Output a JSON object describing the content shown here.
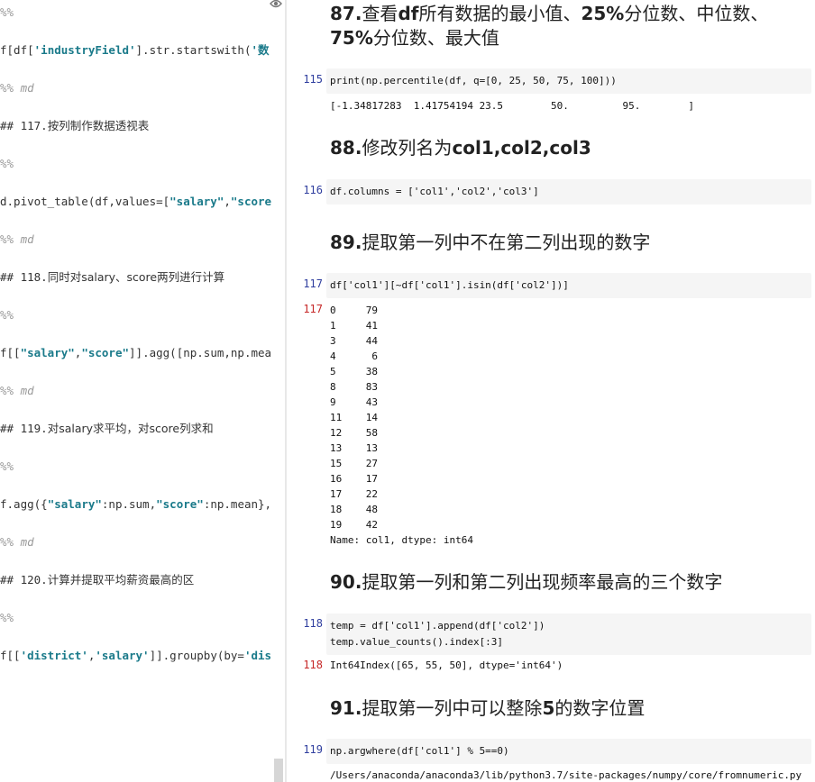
{
  "editor": {
    "sep_marker": "%%",
    "md_marker": "%% md",
    "line_filter_a": "f[df[",
    "line_filter_str": "'industryField'",
    "line_filter_b": "].str.startswith(",
    "line_filter_str2": "'数",
    "h117_prefix": "## 117.",
    "h117_text": "按列制作数据透视表",
    "line_pivot_a": "d.pivot_table(df,values=[",
    "line_pivot_str": "\"salary\"",
    "line_pivot_b": ",",
    "line_pivot_str2": "\"score",
    "h118_prefix": "## 118.",
    "h118_text": "同时对salary、score两列进行计算",
    "line_agg_a": "f[[",
    "line_agg_str": "\"salary\"",
    "line_agg_b": ",",
    "line_agg_str2": "\"score\"",
    "line_agg_c": "]].agg([np.sum,np.mea",
    "h119_prefix": "## 119.",
    "h119_text": "对salary求平均，对score列求和",
    "line_agg2_a": "f.agg({",
    "line_agg2_str": "\"salary\"",
    "line_agg2_b": ":np.sum,",
    "line_agg2_str2": "\"score\"",
    "line_agg2_c": ":np.mean},",
    "h120_prefix": "## 120.",
    "h120_text": "计算并提取平均薪资最高的区",
    "line_group_a": "f[[",
    "line_group_str": "'district'",
    "line_group_b": ",",
    "line_group_str2": "'salary'",
    "line_group_c": "]].groupby(by=",
    "line_group_str3": "'dis"
  },
  "notebook": {
    "h87": {
      "num": "87.",
      "t1": "查看",
      "b1": "df",
      "t2": "所有数据的最小值、",
      "b2": "25%",
      "t3": "分位数、中位数、",
      "b3": "75%",
      "t4": "分位数、最大值"
    },
    "cell115": {
      "prompt": "115",
      "code": "print(np.percentile(df, q=[0, 25, 50, 75, 100]))",
      "output": "[-1.34817283  1.41754194 23.5        50.         95.        ]"
    },
    "h88": {
      "num": "88.",
      "t1": "修改列名为",
      "b1": "col1,col2,col3"
    },
    "cell116": {
      "prompt": "116",
      "code": "df.columns = ['col1','col2','col3']"
    },
    "h89": {
      "num": "89.",
      "t1": "提取第一列中不在第二列出现的数字"
    },
    "cell117": {
      "prompt": "117",
      "code": "df['col1'][~df['col1'].isin(df['col2'])]",
      "out_prompt": "117",
      "output": "0     79\n1     41\n3     44\n4      6\n5     38\n8     83\n9     43\n11    14\n12    58\n13    13\n15    27\n16    17\n17    22\n18    48\n19    42\nName: col1, dtype: int64"
    },
    "h90": {
      "num": "90.",
      "t1": "提取第一列和第二列出现频率最高的三个数字"
    },
    "cell118": {
      "prompt": "118",
      "code": "temp = df['col1'].append(df['col2'])\ntemp.value_counts().index[:3]",
      "out_prompt": "118",
      "output": "Int64Index([65, 55, 50], dtype='int64')"
    },
    "h91": {
      "num": "91.",
      "t1": "提取第一列中可以整除",
      "b1": "5",
      "t2": "的数字位置"
    },
    "cell119": {
      "prompt": "119",
      "code": "np.argwhere(df['col1'] % 5==0)",
      "output": "/Users/anaconda/anaconda3/lib/python3.7/site-packages/numpy/core/fromnumeric.py"
    }
  }
}
